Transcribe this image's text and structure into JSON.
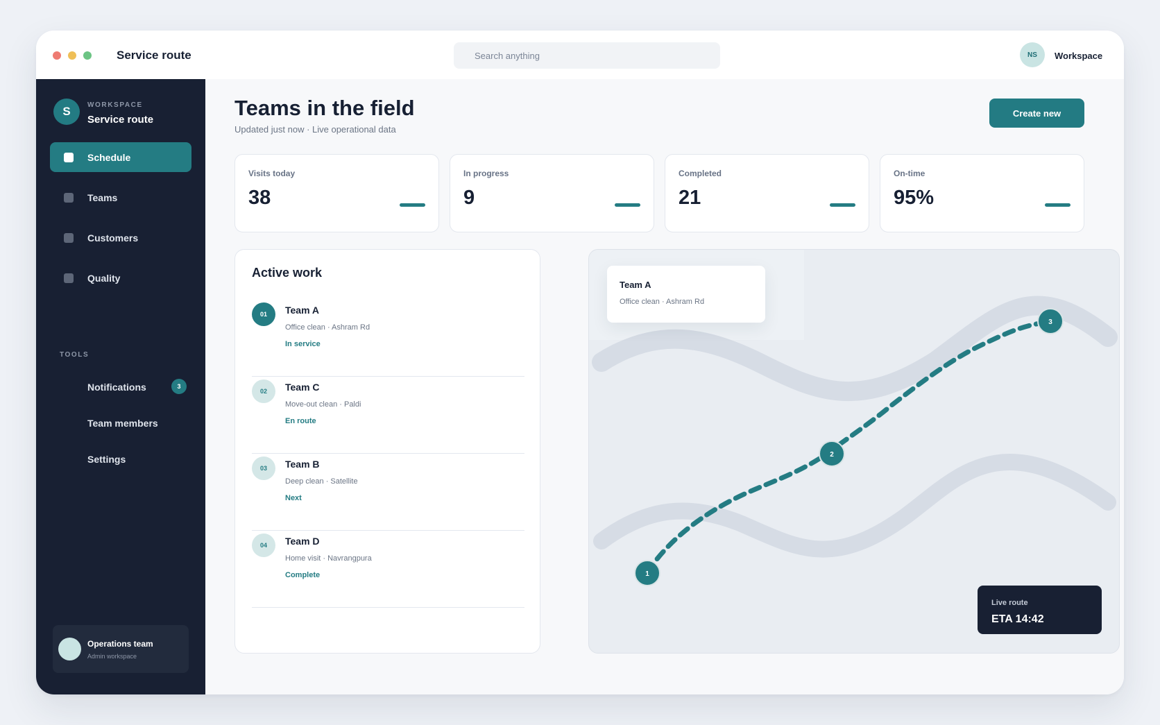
{
  "window": {
    "title": "Service route",
    "search_placeholder": "Search anything",
    "user_initials": "NS",
    "workspace_label": "Workspace"
  },
  "sidebar": {
    "workspace_kicker": "WORKSPACE",
    "workspace_initial": "S",
    "workspace_name": "Service route",
    "nav": [
      {
        "label": "Schedule",
        "active": true
      },
      {
        "label": "Teams",
        "active": false
      },
      {
        "label": "Customers",
        "active": false
      },
      {
        "label": "Quality",
        "active": false
      }
    ],
    "tools_heading": "TOOLS",
    "tools": [
      {
        "label": "Notifications",
        "badge": "3"
      },
      {
        "label": "Team members"
      },
      {
        "label": "Settings"
      }
    ],
    "footer": {
      "name": "Operations team",
      "subtitle": "Admin workspace"
    }
  },
  "header": {
    "title": "Teams in the field",
    "subtitle": "Updated just now · Live operational data",
    "create_label": "Create new"
  },
  "stats": [
    {
      "label": "Visits today",
      "value": "38"
    },
    {
      "label": "In progress",
      "value": "9"
    },
    {
      "label": "Completed",
      "value": "21"
    },
    {
      "label": "On-time",
      "value": "95%"
    }
  ],
  "active_work": {
    "title": "Active work",
    "items": [
      {
        "num": "01",
        "team": "Team A",
        "detail": "Office clean · Ashram Rd",
        "status": "In service"
      },
      {
        "num": "02",
        "team": "Team C",
        "detail": "Move-out clean · Paldi",
        "status": "En route"
      },
      {
        "num": "03",
        "team": "Team B",
        "detail": "Deep clean · Satellite",
        "status": "Next"
      },
      {
        "num": "04",
        "team": "Team D",
        "detail": "Home visit · Navrangpura",
        "status": "Complete"
      }
    ]
  },
  "map": {
    "popup": {
      "title": "Team A",
      "detail": "Office clean · Ashram Rd"
    },
    "stops": [
      "1",
      "2",
      "3"
    ],
    "eta": {
      "label": "Live route",
      "value": "ETA 14:42"
    },
    "colors": {
      "route": "#247c83",
      "road": "#d6dce5",
      "card": "#182033"
    }
  },
  "colors": {
    "accent": "#247c83",
    "sidebar": "#182033",
    "background": "#eef1f6"
  }
}
